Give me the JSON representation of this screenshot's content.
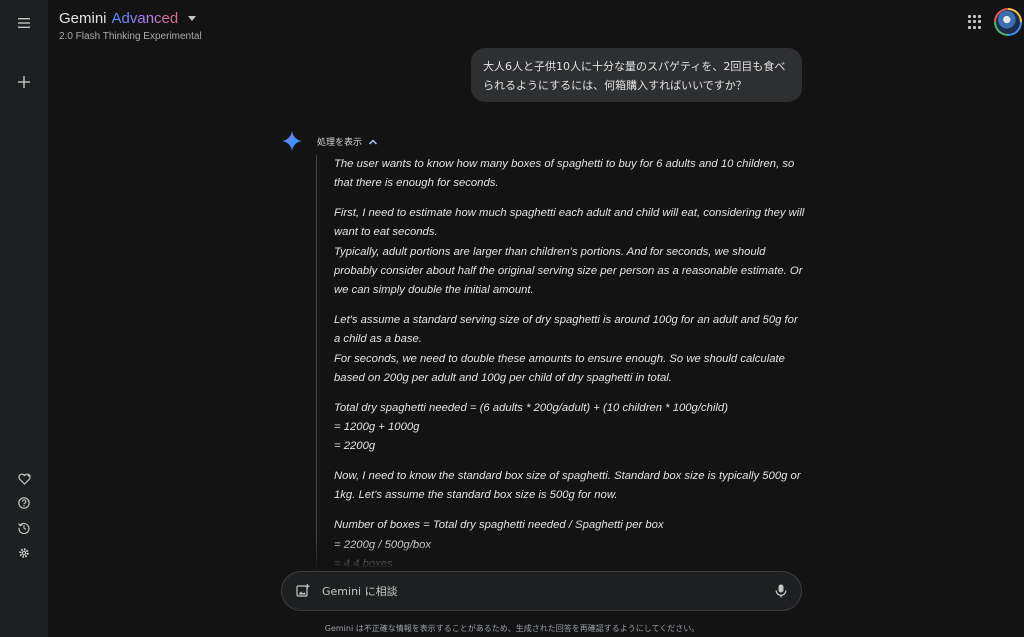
{
  "header": {
    "title": "Gemini",
    "title_accent": "Advanced",
    "model": "2.0 Flash Thinking Experimental"
  },
  "sidebar": {
    "icons": [
      "menu-icon",
      "new-chat-icon",
      "gem-manager-icon",
      "help-icon",
      "activity-icon",
      "settings-icon"
    ]
  },
  "conversation": {
    "user_message": "大人6人と子供10人に十分な量のスパゲティを、2回目も食べられるようにするには、何箱購入すればいいですか？",
    "thoughts_toggle": "処理を表示",
    "thoughts": [
      "The user wants to know how many boxes of spaghetti to buy for 6 adults and 10 children, so that there is enough for seconds.",
      "First, I need to estimate how much spaghetti each adult and child will eat, considering they will want to eat seconds.\nTypically, adult portions are larger than children's portions.  And for seconds, we should probably consider about half the original serving size per person as a reasonable estimate. Or we can simply double the initial amount.",
      "Let's assume a standard serving size of dry spaghetti is around 100g for an adult and 50g for a child as a base.\nFor seconds, we need to double these amounts to ensure enough. So we should calculate based on 200g per adult and 100g per child of dry spaghetti in total.",
      "Total dry spaghetti needed = (6 adults * 200g/adult) + (10 children * 100g/child)\n= 1200g + 1000g\n= 2200g",
      "Now, I need to know the standard box size of spaghetti. Standard box size is typically 500g or 1kg. Let's assume the standard box size is 500g for now.",
      "Number of boxes = Total dry spaghetti needed / Spaghetti per box\n= 2200g / 500g/box\n= 4.4 boxes"
    ]
  },
  "input": {
    "placeholder": "Gemini に相談"
  },
  "footer": {
    "disclaimer": "Gemini は不正確な情報を表示することがあるため、生成された回答を再確認するようにしてください。"
  },
  "colors": {
    "background": "#131314",
    "sidebar": "#1e1f20",
    "bubble": "#2e2f31",
    "accent_blue": "#4b90ff",
    "accent_pink": "#e8697f"
  }
}
